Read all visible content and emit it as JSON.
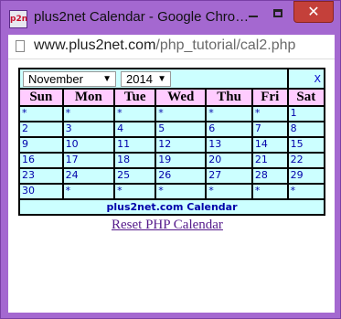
{
  "window": {
    "title": "plus2net Calendar - Google Chro…",
    "app_icon": "p2n",
    "close_glyph": "✕"
  },
  "address": {
    "host": "www.plus2net.com",
    "path": "/php_tutorial/cal2.php"
  },
  "calendar": {
    "month": "November",
    "year": "2014",
    "close_label": "X",
    "days": [
      "Sun",
      "Mon",
      "Tue",
      "Wed",
      "Thu",
      "Fri",
      "Sat"
    ],
    "weeks": [
      [
        "*",
        "*",
        "*",
        "*",
        "*",
        "*",
        "1"
      ],
      [
        "2",
        "3",
        "4",
        "5",
        "6",
        "7",
        "8"
      ],
      [
        "9",
        "10",
        "11",
        "12",
        "13",
        "14",
        "15"
      ],
      [
        "16",
        "17",
        "18",
        "19",
        "20",
        "21",
        "22"
      ],
      [
        "23",
        "24",
        "25",
        "26",
        "27",
        "28",
        "29"
      ],
      [
        "30",
        "*",
        "*",
        "*",
        "*",
        "*",
        "*"
      ]
    ],
    "footer": "plus2net.com Calendar"
  },
  "reset_link": "Reset PHP Calendar",
  "colors": {
    "frame": "#a468d0",
    "calendar_bg": "#ccffff",
    "header_bg": "#ffccff",
    "link": "#551a8b"
  },
  "icons": {
    "app": "plus2net-logo-icon",
    "page": "page-icon",
    "dropdown": "triangle-down-icon"
  }
}
